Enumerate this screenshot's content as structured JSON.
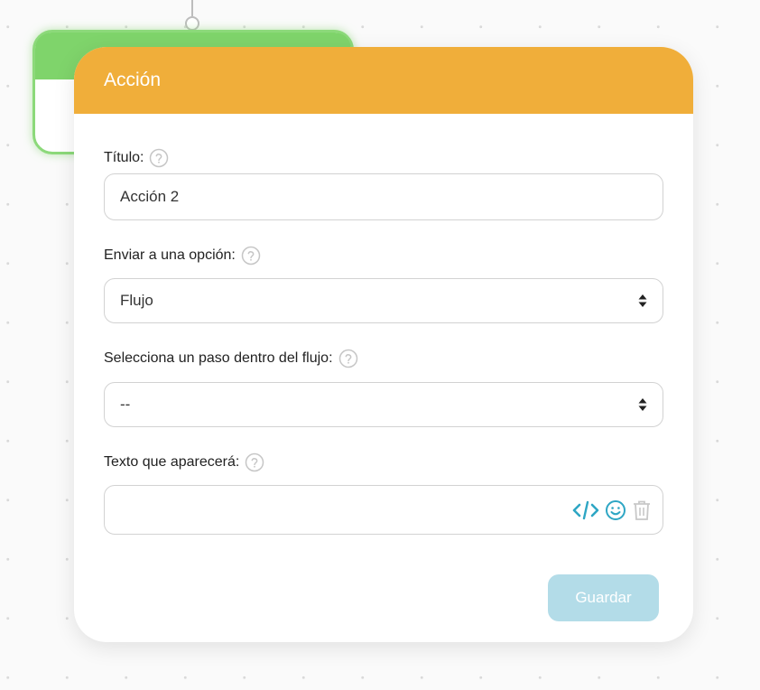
{
  "modal": {
    "title": "Acción",
    "header_color": "#f0ae3a"
  },
  "fields": {
    "title": {
      "label": "Título:",
      "value": "Acción 2"
    },
    "send_to": {
      "label": "Enviar a una opción:",
      "selected": "Flujo"
    },
    "step": {
      "label": "Selecciona un paso dentro del flujo:",
      "selected": "--"
    },
    "text": {
      "label": "Texto que aparecerá:",
      "value": ""
    }
  },
  "icons": {
    "help": "question-circle-icon",
    "select": "sort-arrows-icon",
    "code": "code-icon",
    "emoji": "smiley-icon",
    "delete": "trash-icon"
  },
  "actions": {
    "save_label": "Guardar",
    "save_color": "#b3dce8"
  },
  "colors": {
    "accent_teal": "#2ea6c4",
    "node_green": "#7fd46b"
  }
}
